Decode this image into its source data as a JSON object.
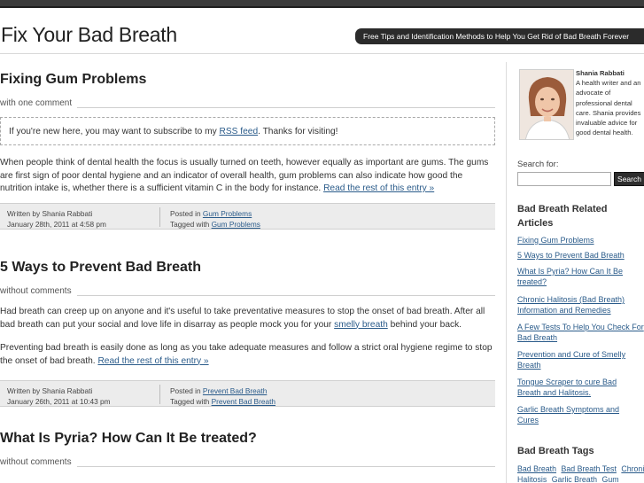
{
  "site": {
    "title": "Fix Your Bad Breath",
    "tagline": "Free Tips and Identification Methods to Help You Get Rid of Bad Breath Forever"
  },
  "posts": [
    {
      "title": "Fixing Gum Problems",
      "comments": "with one comment",
      "rss_notice": {
        "before": "If you're new here, you may want to subscribe to my ",
        "link": "RSS feed",
        "after": ". Thanks for visiting!"
      },
      "paragraphs": [
        {
          "text": "When people think of dental health the focus is usually turned on teeth, however equally as important are gums. The gums are first sign of poor dental hygiene and an indicator of overall health, gum problems can also indicate how good the nutrition intake is, whether there is a sufficient vitamin C in the body for instance. ",
          "link": "Read the rest of this entry »"
        }
      ],
      "meta": {
        "written_by": "Written by Shania Rabbati",
        "date": "January 28th, 2011 at 4:58 pm",
        "posted_in_label": "Posted in ",
        "posted_in": "Gum Problems",
        "tagged_label": "Tagged with ",
        "tagged": "Gum Problems"
      }
    },
    {
      "title": "5 Ways to Prevent Bad Breath",
      "comments": "without comments",
      "paragraphs": [
        {
          "text": "Had breath can creep up on anyone and it's useful to take preventative measures to stop the onset of bad breath. After all bad breath can put your social and love life in disarray as people mock you for your ",
          "link": "smelly breath",
          "after": " behind your back."
        },
        {
          "text": "Preventing bad breath is easily done as long as you take adequate measures and follow a strict oral hygiene regime to stop the onset of bad breath. ",
          "link": "Read the rest of this entry »"
        }
      ],
      "meta": {
        "written_by": "Written by Shania Rabbati",
        "date": "January 26th, 2011 at 10:43 pm",
        "posted_in_label": "Posted in ",
        "posted_in": "Prevent Bad Breath",
        "tagged_label": "Tagged with ",
        "tagged": "Prevent Bad Breath"
      }
    },
    {
      "title": "What Is Pyria? How Can It Be treated?",
      "comments": "without comments"
    }
  ],
  "sidebar": {
    "author": {
      "name": "Shania Rabbati",
      "bio": "A health writer and an advocate of professional dental care. Shania provides invaluable advice for good dental health."
    },
    "search": {
      "label": "Search for:",
      "placeholder": "",
      "button": "Search"
    },
    "related_heading": "Bad Breath Related Articles",
    "related_links": [
      "Fixing Gum Problems",
      "5 Ways to Prevent Bad Breath",
      "What Is Pyria? How Can It Be treated?",
      "Chronic Halitosis (Bad Breath) Information and Remedies",
      "A Few Tests To Help You Check For Bad Breath",
      "Prevention and Cure of Smelly Breath",
      "Tongue Scraper to cure Bad Breath and Halitosis.",
      "Garlic Breath Symptoms and Cures"
    ],
    "tags_heading": "Bad Breath Tags",
    "tags": [
      "Bad Breath",
      "Bad Breath Test",
      "Chronic Halitosis",
      "Garlic Breath",
      "Gum"
    ]
  },
  "colors": {
    "link": "#2a5b8a",
    "topbar": "#3c3c3c",
    "tagline_bg": "#2b2b2b",
    "meta_bg": "#ececec"
  }
}
